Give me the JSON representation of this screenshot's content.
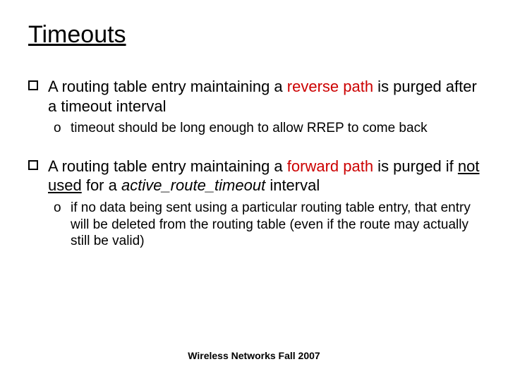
{
  "title": "Timeouts",
  "bullets": [
    {
      "pre": "A routing table entry maintaining a ",
      "hl": "reverse path",
      "post": " is purged after a timeout interval",
      "sub": "timeout should be long enough to allow RREP to come back"
    },
    {
      "pre": "A routing table entry maintaining a ",
      "hl": "forward path",
      "post1": " is purged if ",
      "not_used": "not used",
      "post2": " for a ",
      "ital": "active_route_timeout",
      "post3": " interval",
      "sub": "if no data being sent using a particular routing table entry,  that entry will be deleted from the routing table (even if the route may actually still be valid)"
    }
  ],
  "footer": "Wireless Networks Fall 2007"
}
